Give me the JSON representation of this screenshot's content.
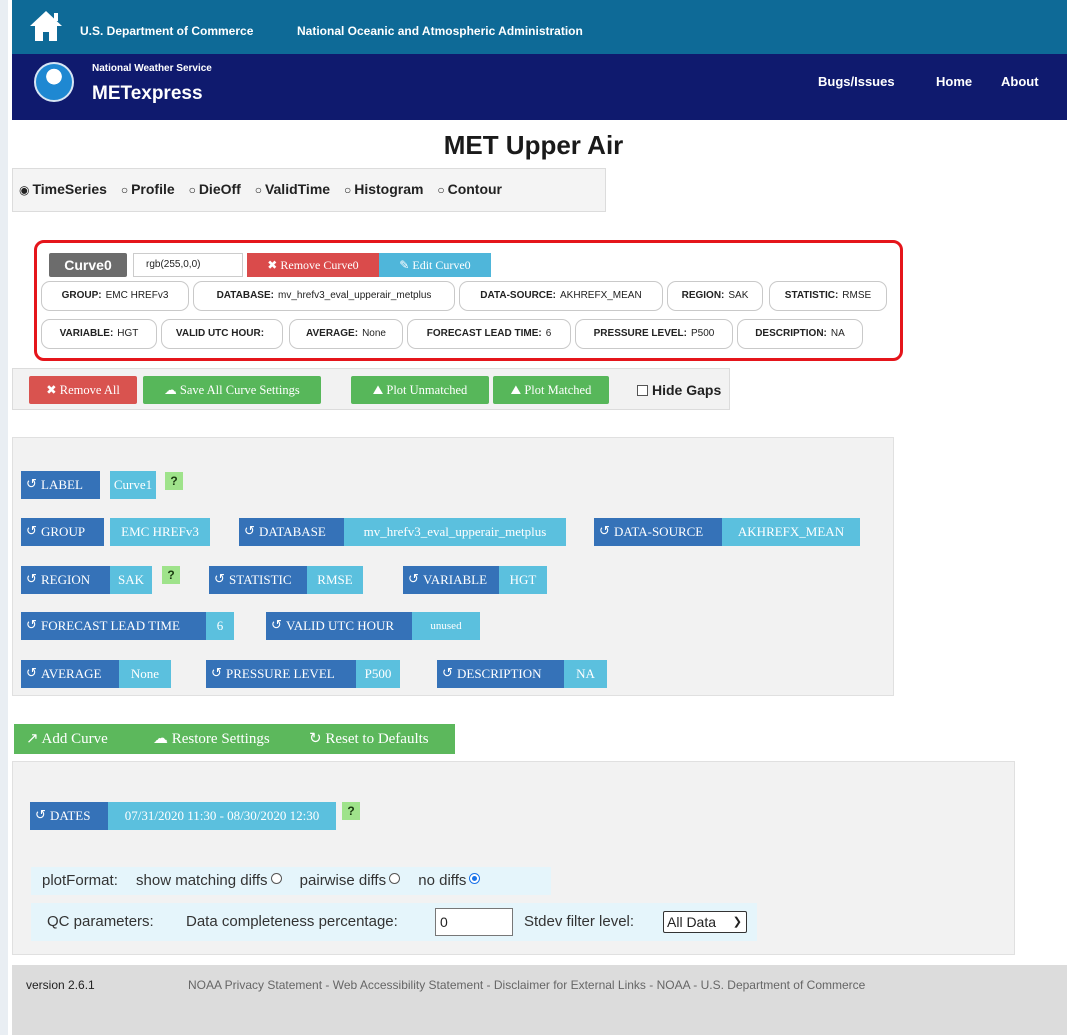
{
  "header": {
    "dept_link": "U.S. Department of Commerce",
    "noaa_link": "National Oceanic and Atmospheric Administration",
    "service_name": "National Weather Service",
    "app_name": "METexpress",
    "nav": {
      "bugs": "Bugs/Issues",
      "home": "Home",
      "about": "About"
    }
  },
  "page_title": "MET Upper Air",
  "plot_types": {
    "selected": "TimeSeries",
    "options": [
      "TimeSeries",
      "Profile",
      "DieOff",
      "ValidTime",
      "Histogram",
      "Contour"
    ]
  },
  "curve": {
    "name": "Curve0",
    "color": "rgb(255,0,0)",
    "remove_label": "Remove Curve0",
    "edit_label": "Edit Curve0",
    "params": [
      {
        "key": "GROUP:",
        "value": "EMC HREFv3"
      },
      {
        "key": "DATABASE:",
        "value": "mv_hrefv3_eval_upperair_metplus"
      },
      {
        "key": "DATA-SOURCE:",
        "value": "AKHREFX_MEAN"
      },
      {
        "key": "REGION:",
        "value": "SAK"
      },
      {
        "key": "STATISTIC:",
        "value": "RMSE"
      },
      {
        "key": "VARIABLE:",
        "value": "HGT"
      },
      {
        "key": "VALID UTC HOUR:",
        "value": ""
      },
      {
        "key": "AVERAGE:",
        "value": "None"
      },
      {
        "key": "FORECAST LEAD TIME:",
        "value": "6"
      },
      {
        "key": "PRESSURE LEVEL:",
        "value": "P500"
      },
      {
        "key": "DESCRIPTION:",
        "value": "NA"
      }
    ]
  },
  "actions": {
    "remove_all": "Remove All",
    "save_all": "Save All Curve Settings",
    "plot_unmatched": "Plot Unmatched",
    "plot_matched": "Plot Matched",
    "hide_gaps": "Hide Gaps"
  },
  "selectors": {
    "label": {
      "key": "LABEL",
      "value": "Curve1"
    },
    "group": {
      "key": "GROUP",
      "value": "EMC HREFv3"
    },
    "database": {
      "key": "DATABASE",
      "value": "mv_hrefv3_eval_upperair_metplus"
    },
    "data_source": {
      "key": "DATA-SOURCE",
      "value": "AKHREFX_MEAN"
    },
    "region": {
      "key": "REGION",
      "value": "SAK"
    },
    "statistic": {
      "key": "STATISTIC",
      "value": "RMSE"
    },
    "variable": {
      "key": "VARIABLE",
      "value": "HGT"
    },
    "forecast_lead": {
      "key": "FORECAST LEAD TIME",
      "value": "6"
    },
    "valid_hour": {
      "key": "VALID UTC HOUR",
      "value": "unused"
    },
    "average": {
      "key": "AVERAGE",
      "value": "None"
    },
    "pressure_level": {
      "key": "PRESSURE LEVEL",
      "value": "P500"
    },
    "description": {
      "key": "DESCRIPTION",
      "value": "NA"
    },
    "help": "?"
  },
  "curve_buttons": {
    "add": "Add Curve",
    "restore": "Restore Settings",
    "reset": "Reset to Defaults"
  },
  "dates": {
    "key": "DATES",
    "value": "07/31/2020 11:30 - 08/30/2020 12:30"
  },
  "plot_format": {
    "label": "plotFormat:",
    "options": [
      "show matching diffs",
      "pairwise diffs",
      "no diffs"
    ],
    "selected": "no diffs"
  },
  "qc": {
    "label": "QC parameters:",
    "completeness_label": "Data completeness percentage:",
    "completeness_value": "0",
    "stdev_label": "Stdev filter level:",
    "stdev_value": "All Data"
  },
  "footer": {
    "version": "version 2.6.1",
    "links": "NOAA Privacy Statement - Web Accessibility Statement - Disclaimer for External Links - NOAA - U.S. Department of Commerce"
  }
}
